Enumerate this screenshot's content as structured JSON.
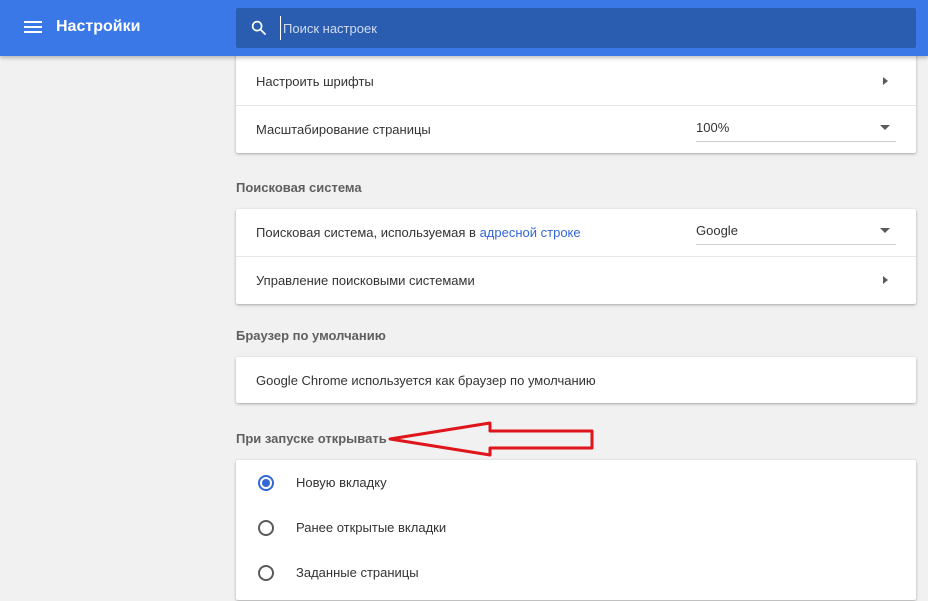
{
  "toolbar": {
    "title": "Настройки",
    "search_placeholder": "Поиск настроек",
    "icons": {
      "menu": "hamburger-menu-icon",
      "search": "search-icon"
    },
    "color": "#3b78e7"
  },
  "appearance": {
    "fonts_label": "Настроить шрифты",
    "zoom_label": "Масштабирование страницы",
    "zoom_value": "100%"
  },
  "search_engine": {
    "section_title": "Поисковая система",
    "engine_label_prefix": "Поисковая система, используемая в ",
    "engine_label_link": "адресной строке",
    "engine_value": "Google",
    "manage_label": "Управление поисковыми системами"
  },
  "default_browser": {
    "section_title": "Браузер по умолчанию",
    "status_text": "Google Chrome используется как браузер по умолчанию"
  },
  "on_startup": {
    "section_title": "При запуске открывать",
    "options": [
      {
        "label": "Новую вкладку",
        "checked": true
      },
      {
        "label": "Ранее открытые вкладки",
        "checked": false
      },
      {
        "label": "Заданные страницы",
        "checked": false
      }
    ]
  },
  "annotation": {
    "color": "#e0141b"
  }
}
